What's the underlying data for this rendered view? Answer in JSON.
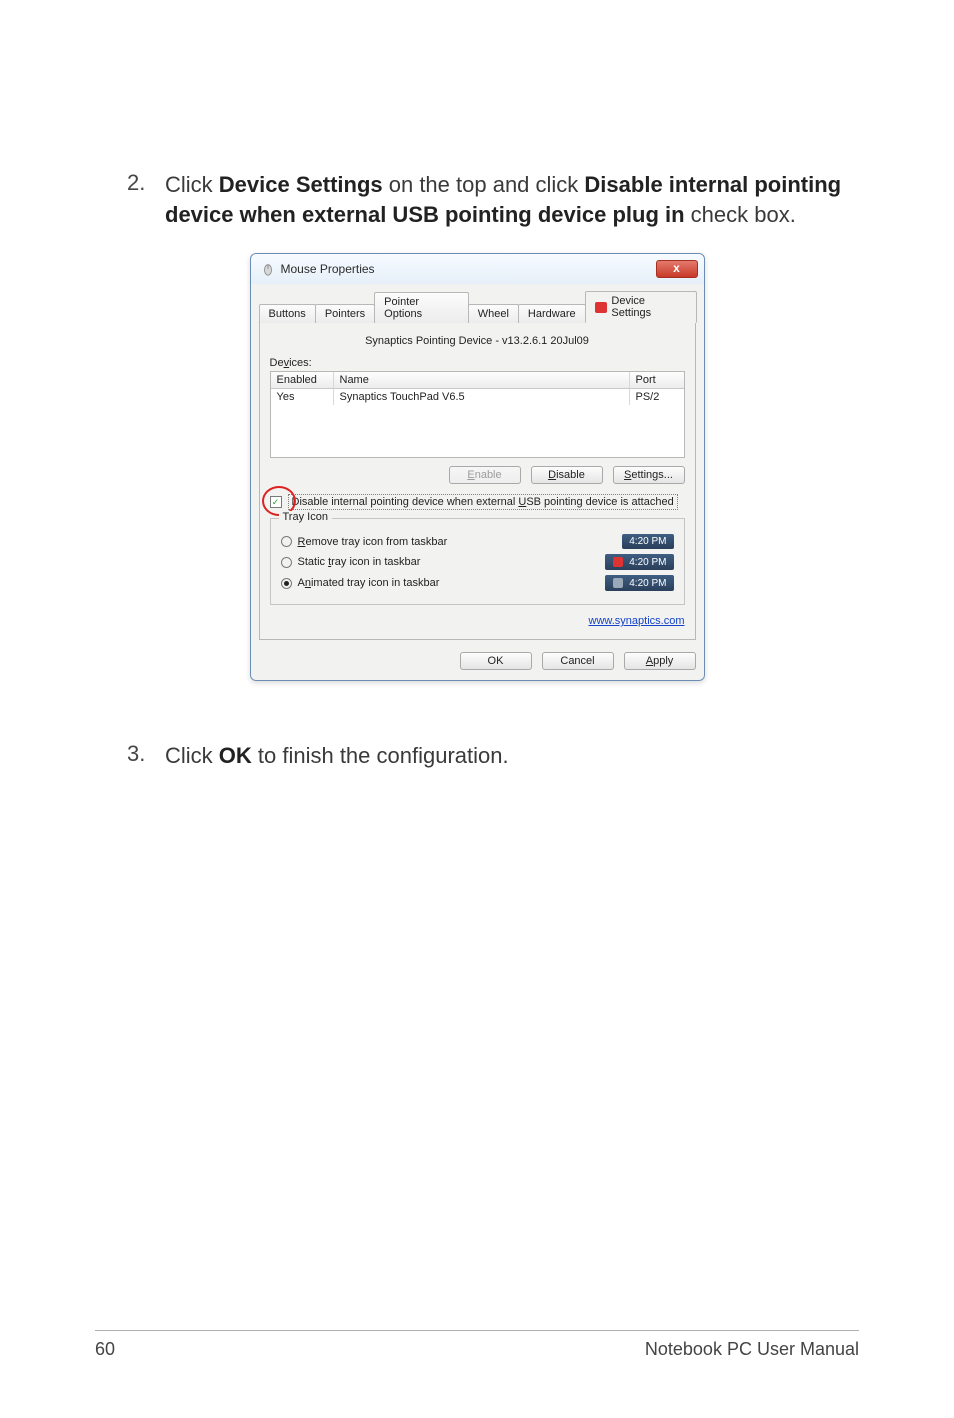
{
  "steps": {
    "s2": {
      "num": "2.",
      "pre1": "Click ",
      "bold1": "Device Settings",
      "mid1": " on the top and click ",
      "bold2": "Disable internal pointing device when external USB pointing device plug in",
      "post1": " check box."
    },
    "s3": {
      "num": "3.",
      "pre1": "Click ",
      "bold1": "OK",
      "post1": " to finish the configuration."
    }
  },
  "dialog": {
    "title": "Mouse Properties",
    "close": "x",
    "tabs": {
      "buttons": "Buttons",
      "pointers": "Pointers",
      "pointer_options": "Pointer Options",
      "wheel": "Wheel",
      "hardware": "Hardware",
      "device_settings": "Device Settings"
    },
    "version": "Synaptics Pointing Device - v13.2.6.1 20Jul09",
    "devices_label": "Devices:",
    "cols": {
      "enabled": "Enabled",
      "name": "Name",
      "port": "Port"
    },
    "row": {
      "enabled": "Yes",
      "name": "Synaptics TouchPad V6.5",
      "port": "PS/2"
    },
    "buttons": {
      "enable": "Enable",
      "disable": "Disable",
      "settings": "Settings..."
    },
    "checkbox_label": "Disable internal pointing device when external USB pointing device is attached",
    "tray_legend": "Tray Icon",
    "radios": {
      "remove": "Remove tray icon from taskbar",
      "static": "Static tray icon in taskbar",
      "animated": "Animated tray icon in taskbar"
    },
    "time": "4:20 PM",
    "link": "www.synaptics.com",
    "ok": "OK",
    "cancel": "Cancel",
    "apply": "Apply"
  },
  "footer": {
    "page": "60",
    "manual": "Notebook PC User Manual"
  }
}
